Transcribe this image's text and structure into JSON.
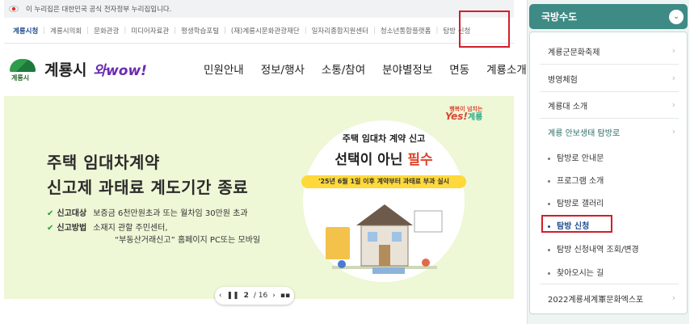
{
  "gov_notice": "이 누리집은 대한민국 공식 전자정부 누리집입니다.",
  "site_tabs": [
    "계룡시청",
    "계룡시의회",
    "문화관광",
    "미디어자료관",
    "평생학습포털",
    "(재)계룡시문화관광재단",
    "일자리종합지원센터",
    "청소년통합플랫폼",
    "탐방 신청"
  ],
  "logo": {
    "mark_label": "계룡시",
    "name": "계룡시",
    "slogan": "와wow!"
  },
  "nav": [
    "민원안내",
    "정보/행사",
    "소통/참여",
    "분야별정보",
    "면동",
    "계룡소개"
  ],
  "banner": {
    "title_line1": "주택 임대차계약",
    "title_line2": "신고제 과태료 계도기간 종료",
    "row1_key": "신고대상",
    "row1_val": "보증금 6천만원초과 또는 월차임 30만원 초과",
    "row2_key": "신고방법",
    "row2_val": "소재지 관할 주민센터,",
    "row2_val2": "“부동산거래신고” 홈페이지 PC또는 모바일",
    "yes_small": "행복이 넘치는",
    "yes_big": "Yes!",
    "yes_city": "계룡",
    "circle_head": "주택 임대차 계약 신고",
    "circle_main_a": "선택이 아닌",
    "circle_main_b": "필수",
    "circle_note": "'25년 6월 1일 이후 계약부터 과태료 부과 실시",
    "check": "✔"
  },
  "pager": {
    "prev": "‹",
    "pause": "❚❚",
    "current": "2",
    "total": "/ 16",
    "next": "›",
    "grid": "▪▪"
  },
  "sidebar": {
    "title": "국방수도",
    "collapse": "⌄",
    "items": [
      "계룡군문화축제",
      "병영체험",
      "계룡대 소개",
      "계룡 안보생태 탐방로"
    ],
    "subs": [
      "탐방로 안내문",
      "프로그램 소개",
      "탐방로 갤러리",
      "탐방 신청",
      "탐방 신청내역 조회/변경",
      "찾아오시는 길"
    ],
    "last": "2022계룡세계軍문화엑스포",
    "chevron": "›"
  },
  "colors": {
    "sidebar_header": "#3e8a85",
    "highlight": "#d21f2b",
    "active_link": "#1f4d8f",
    "banner_bg": "#eef7d6"
  }
}
